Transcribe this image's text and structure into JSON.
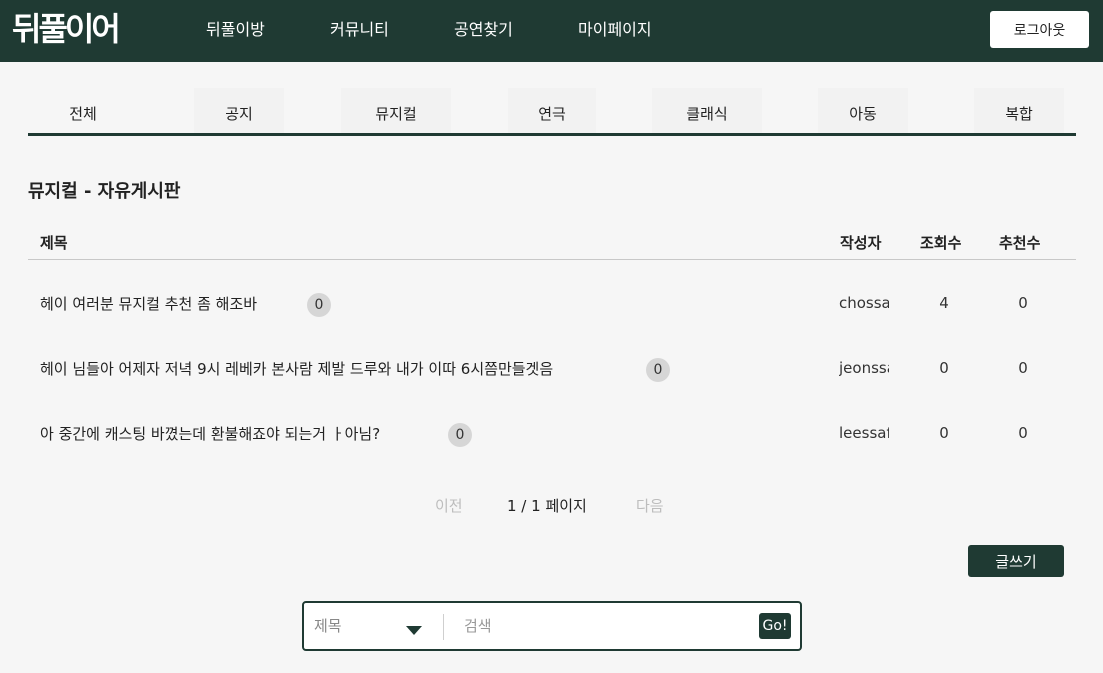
{
  "header": {
    "logo": "뒤풀이어",
    "nav": [
      "뒤풀이방",
      "커뮤니티",
      "공연찾기",
      "마이페이지"
    ],
    "logout_label": "로그아웃"
  },
  "tabs": [
    "전체",
    "공지",
    "뮤지컬",
    "연극",
    "클래식",
    "아동",
    "복합"
  ],
  "board": {
    "title": "뮤지컬 - 자유게시판",
    "columns": [
      "제목",
      "작성자",
      "조회수",
      "추천수"
    ],
    "posts": [
      {
        "title": "헤이 여러분 뮤지컬 추천 좀 해조바",
        "comments": "0",
        "author": "chossa",
        "views": "4",
        "likes": "0"
      },
      {
        "title": "헤이 님들아 어제자 저녁 9시 레베카 본사람 제발 드루와 내가 이따 6시쯤만들겟음",
        "comments": "0",
        "author": "jeonssa",
        "views": "0",
        "likes": "0"
      },
      {
        "title": "아 중간에 캐스팅 바꼈는데 환불해죠야 되는거 ㅏ아님?",
        "comments": "0",
        "author": "leessaf",
        "views": "0",
        "likes": "0"
      }
    ]
  },
  "pagination": {
    "prev": "이전",
    "info": "1 / 1 페이지",
    "next": "다음"
  },
  "write_label": "글쓰기",
  "search": {
    "filter_value": "제목",
    "placeholder": "검색",
    "go_label": "Go!"
  },
  "colors": {
    "primary": "#1f3a33",
    "background": "#f6f6f6",
    "badge": "#d6d6d6"
  }
}
